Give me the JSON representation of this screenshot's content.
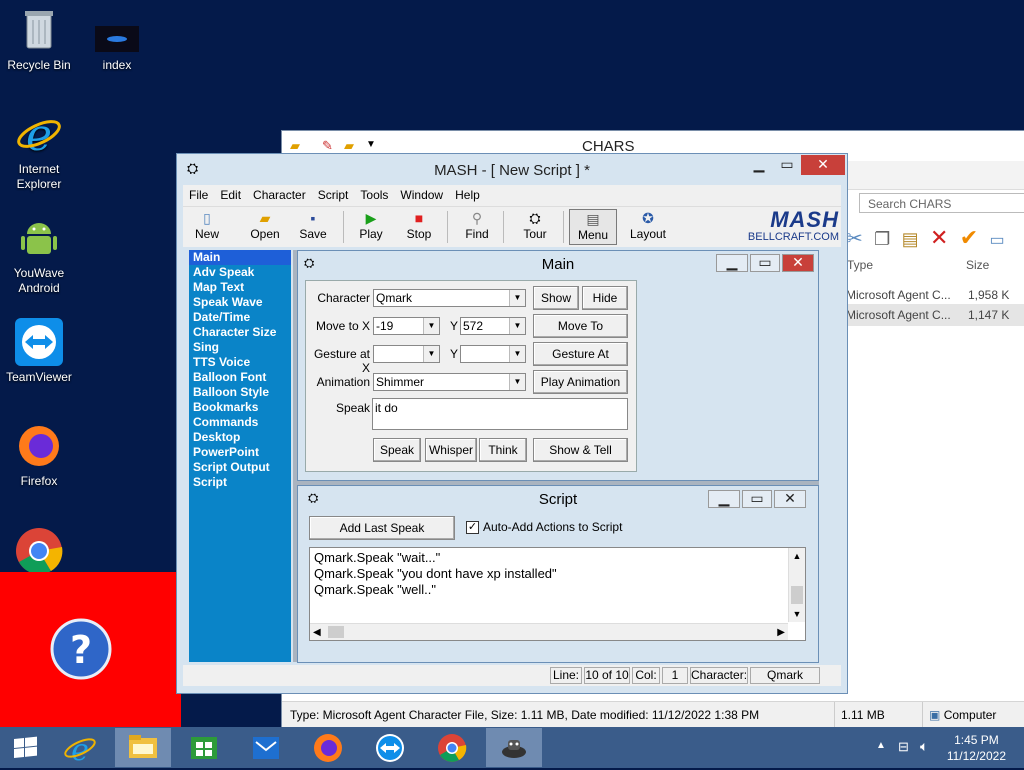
{
  "desktop": {
    "icons": [
      {
        "label": "Recycle Bin"
      },
      {
        "label": "index"
      },
      {
        "label": "Internet\nExplorer"
      },
      {
        "label": "YouWave\nAndroid"
      },
      {
        "label": "TeamViewer"
      },
      {
        "label": "Firefox"
      }
    ]
  },
  "explorer": {
    "title": "CHARS",
    "search_placeholder": "Search CHARS",
    "columns": {
      "type": "Type",
      "size": "Size"
    },
    "rows": [
      {
        "type": "Microsoft Agent C...",
        "size": "1,958 K"
      },
      {
        "type": "Microsoft Agent C...",
        "size": "1,147 K"
      }
    ],
    "status": {
      "info": "Type: Microsoft Agent Character File, Size: 1.11 MB, Date modified: 11/12/2022 1:38 PM",
      "size": "1.11 MB",
      "location": "Computer"
    }
  },
  "mash": {
    "title": "MASH - [ New Script ] *",
    "menu": [
      "File",
      "Edit",
      "Character",
      "Script",
      "Tools",
      "Window",
      "Help"
    ],
    "toolbar": {
      "new": "New",
      "open": "Open",
      "save": "Save",
      "play": "Play",
      "stop": "Stop",
      "find": "Find",
      "tour": "Tour",
      "menu": "Menu",
      "layout": "Layout"
    },
    "logo": {
      "name": "MASH",
      "site": "BELLCRAFT.COM"
    },
    "left_items": [
      "Main",
      "Adv Speak",
      "Map Text",
      "Speak Wave",
      "Date/Time",
      "Character Size",
      "Sing",
      "TTS Voice",
      "Balloon Font",
      "Balloon Style",
      "Bookmarks",
      "Commands",
      "Desktop",
      "PowerPoint",
      "Script Output",
      "Script"
    ],
    "main_window": {
      "title": "Main",
      "character_label": "Character",
      "character_value": "Qmark",
      "show": "Show",
      "hide": "Hide",
      "move_label": "Move to X",
      "move_x": "-19",
      "y_label": "Y",
      "move_y": "572",
      "move_to": "Move To",
      "gesture_label": "Gesture at X",
      "gesture_y_label": "Y",
      "gesture_at": "Gesture At",
      "animation_label": "Animation",
      "animation_value": "Shimmer",
      "play_animation": "Play Animation",
      "speak_label": "Speak",
      "speak_text": "it do",
      "speak": "Speak",
      "whisper": "Whisper",
      "think": "Think",
      "show_tell": "Show & Tell"
    },
    "script_window": {
      "title": "Script",
      "add_last_speak": "Add Last Speak",
      "auto_add": "Auto-Add Actions to Script",
      "lines": [
        "Qmark.Speak \"wait...\"",
        "Qmark.Speak \"you dont have xp installed\"",
        "Qmark.Speak \"well..\""
      ]
    },
    "status": {
      "line_label": "Line:",
      "line_value": "10 of 10",
      "col_label": "Col:",
      "col_value": "1",
      "character_label": "Character:",
      "character_value": "Qmark"
    }
  },
  "taskbar": {
    "time": "1:45 PM",
    "date": "11/12/2022"
  },
  "colors": {
    "left_panel": "#0a84c8",
    "selected_item": "#1e5fd8",
    "close_button": "#c8403a",
    "red_overlay": "#ff0000",
    "taskbar": "#3a5c8a"
  }
}
